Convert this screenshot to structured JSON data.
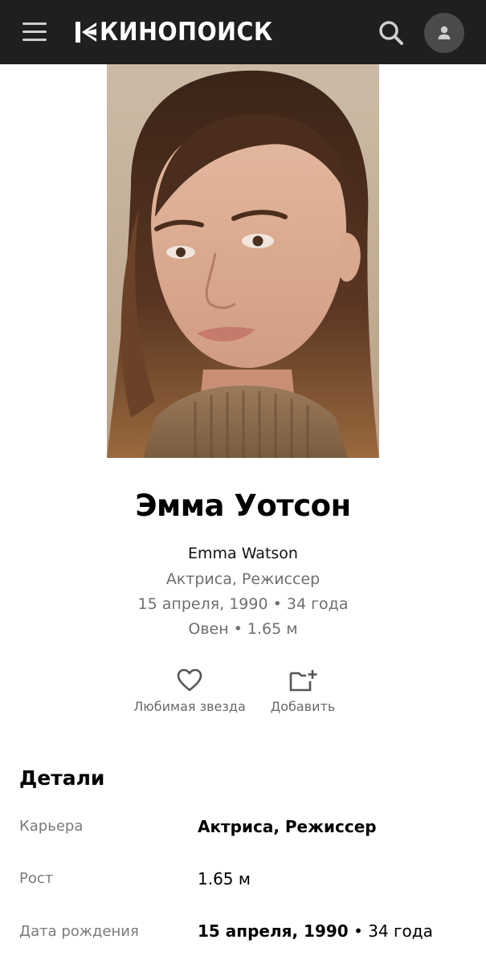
{
  "header": {
    "logo_text": "КИНОПОИСК",
    "background": "#1f1f1f"
  },
  "icons": {
    "menu": "hamburger-menu-icon",
    "search": "search-icon",
    "avatar": "user-icon",
    "favorite": "heart-icon",
    "add": "folder-plus-icon"
  },
  "person": {
    "name_ru": "Эмма Уотсон",
    "name_en": "Emma Watson",
    "roles": "Актриса, Режиссер",
    "birth_line": "15 апреля, 1990 • 34 года",
    "sign_height_line": "Овен • 1.65 м"
  },
  "actions": {
    "favorite_label": "Любимая звезда",
    "add_label": "Добавить"
  },
  "details": {
    "title": "Детали",
    "career_label": "Карьера",
    "career_value": "Актриса, Режиссер",
    "height_label": "Рост",
    "height_value": "1.65 м",
    "birth_label": "Дата рождения",
    "birth_date": "15 апреля, 1990",
    "birth_age": "• 34 года"
  }
}
